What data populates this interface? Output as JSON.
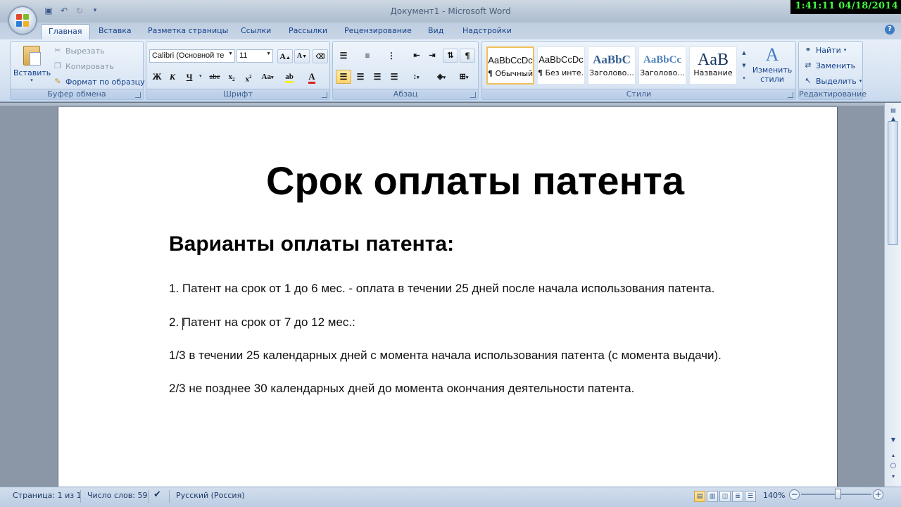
{
  "window": {
    "title": "Документ1 - Microsoft Word"
  },
  "overlay": {
    "clock": "1:41:11  04/18/2014"
  },
  "tabs": [
    "Главная",
    "Вставка",
    "Разметка страницы",
    "Ссылки",
    "Рассылки",
    "Рецензирование",
    "Вид",
    "Надстройки"
  ],
  "clipboard": {
    "paste": "Вставить",
    "cut": "Вырезать",
    "copy": "Копировать",
    "format_painter": "Формат по образцу",
    "label": "Буфер обмена"
  },
  "font": {
    "name": "Calibri (Основной те",
    "size": "11",
    "label": "Шрифт",
    "aa": "Aa"
  },
  "paragraph": {
    "label": "Абзац"
  },
  "styles": {
    "label": "Стили",
    "items": [
      {
        "sample": "AaBbCcDc",
        "name": "¶ Обычный"
      },
      {
        "sample": "AaBbCcDc",
        "name": "¶ Без инте..."
      },
      {
        "sample": "AaBbC",
        "name": "Заголово..."
      },
      {
        "sample": "AaBbCc",
        "name": "Заголово..."
      },
      {
        "sample": "AaB",
        "name": "Название"
      }
    ],
    "change": "Изменить стили"
  },
  "editing": {
    "find": "Найти",
    "replace": "Заменить",
    "select": "Выделить",
    "label": "Редактирование"
  },
  "document": {
    "title": "Срок оплаты патента",
    "heading": "Варианты оплаты патента:",
    "paragraphs": [
      "1. Патент на срок от 1 до 6 мес. - оплата в течении 25 дней после начала использования патента.",
      "2. Патент на срок от 7 до 12 мес.:",
      "1/3 в течении 25 календарных дней с момента начала использования патента (с момента выдачи).",
      "2/3 не позднее 30 календарных дней до момента окончания деятельности патента."
    ]
  },
  "status": {
    "page": "Страница: 1 из 1",
    "words": "Число слов: 59",
    "language": "Русский (Россия)",
    "zoom": "140%"
  }
}
